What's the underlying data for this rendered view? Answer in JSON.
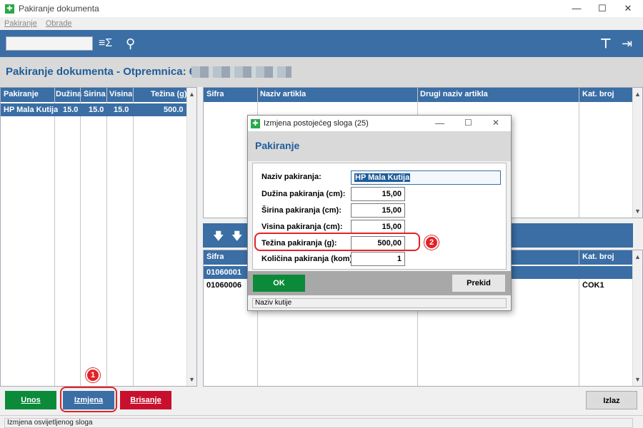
{
  "window": {
    "title": "Pakiranje dokumenta",
    "minimize": "—",
    "maximize": "☐",
    "close": "✕"
  },
  "menu": {
    "items": [
      "Pakiranje",
      "Obrade"
    ]
  },
  "toolbar": {
    "sum_icon": "≡Σ",
    "location_icon": "⚲",
    "tool_icon": "⊤",
    "exit_icon": "⇥"
  },
  "header": {
    "title": "Pakiranje dokumenta - Otpremnica: 69,"
  },
  "left_grid": {
    "columns": [
      "Pakiranje",
      "Dužina",
      "Širina",
      "Visina",
      "Težina (g)"
    ],
    "rows": [
      {
        "pakiranje": "HP Mala Kutija",
        "duzina": "15.0",
        "sirina": "15.0",
        "visina": "15.0",
        "tezina": "500.0"
      }
    ]
  },
  "right_top_grid": {
    "columns": [
      "Šifra",
      "Naziv artikla",
      "Drugi naziv artikla",
      "Kat. broj"
    ]
  },
  "right_bottom_grid": {
    "columns": [
      "Šifra",
      "Kat. broj"
    ],
    "rows": [
      {
        "sifra": "01060001",
        "kat": ""
      },
      {
        "sifra": "01060006",
        "kat": "ČOK1"
      }
    ]
  },
  "midbar": {
    "down_icon": "🡇",
    "down_plus_icon": "🡇"
  },
  "buttons": {
    "unos": "Unos",
    "izmjena": "Izmjena",
    "brisanje": "Brisanje",
    "izlaz": "Izlaz"
  },
  "status": {
    "text": "Izmjena osvijetljenog sloga"
  },
  "annotations": {
    "one": "1",
    "two": "2"
  },
  "dialog": {
    "title": "Izmjena postojećeg sloga  (25)",
    "heading": "Pakiranje",
    "fields": [
      {
        "label": "Naziv pakiranja:",
        "value": "HP Mala Kutija"
      },
      {
        "label": "Dužina pakiranja (cm):",
        "value": "15,00"
      },
      {
        "label": "Širina pakiranja (cm):",
        "value": "15,00"
      },
      {
        "label": "Visina pakiranja (cm):",
        "value": "15,00"
      },
      {
        "label": "Težina pakiranja (g):",
        "value": "500,00"
      },
      {
        "label": "Količina pakiranja (kom):",
        "value": "1"
      }
    ],
    "ok": "OK",
    "cancel": "Prekid",
    "status": "Naziv kutije"
  },
  "colors": {
    "blue": "#3a6ea5",
    "green": "#0b8a3a",
    "red": "#c8102e",
    "annotation_red": "#e32227"
  }
}
